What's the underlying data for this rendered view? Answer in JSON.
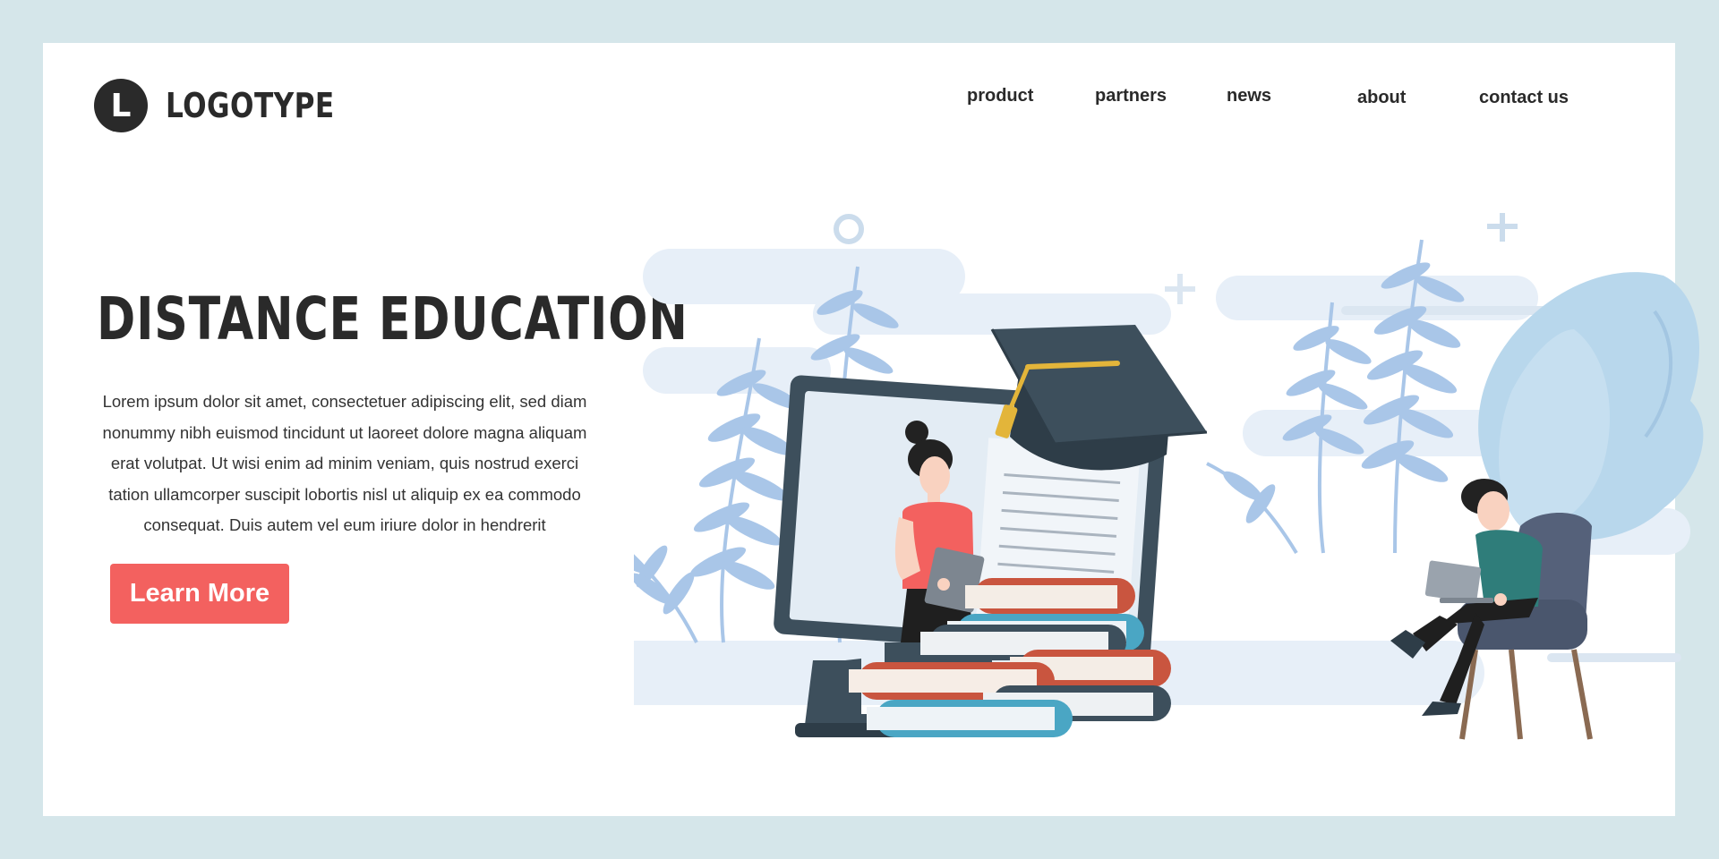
{
  "logo": {
    "letter": "L",
    "text": "LOGOTYPE"
  },
  "nav": {
    "product": "product",
    "partners": "partners",
    "news": "news",
    "about": "about",
    "contact": "contact us"
  },
  "hero": {
    "title": "DISTANCE EDUCATION",
    "body": "Lorem ipsum dolor sit amet, consectetuer adipiscing elit, sed diam nonummy nibh euismod tincidunt ut laoreet dolore magna aliquam erat volutpat. Ut wisi enim ad minim veniam, quis nostrud exerci tation ullamcorper suscipit lobortis nisl ut aliquip ex ea commodo consequat. Duis autem vel eum iriure dolor in hendrerit",
    "cta_label": "Learn More"
  },
  "colors": {
    "page_bg": "#d5e6ea",
    "card_bg": "#ffffff",
    "text_dark": "#2a2a2a",
    "accent_red": "#f3615f",
    "monitor": "#3d4f5c",
    "leaf_blue": "#a9c6e8",
    "book_red": "#c9553f",
    "book_teal": "#4aa6c4"
  },
  "icons": [
    "logo-badge",
    "graduation-cap-icon",
    "plus-icon",
    "circle-icon"
  ]
}
